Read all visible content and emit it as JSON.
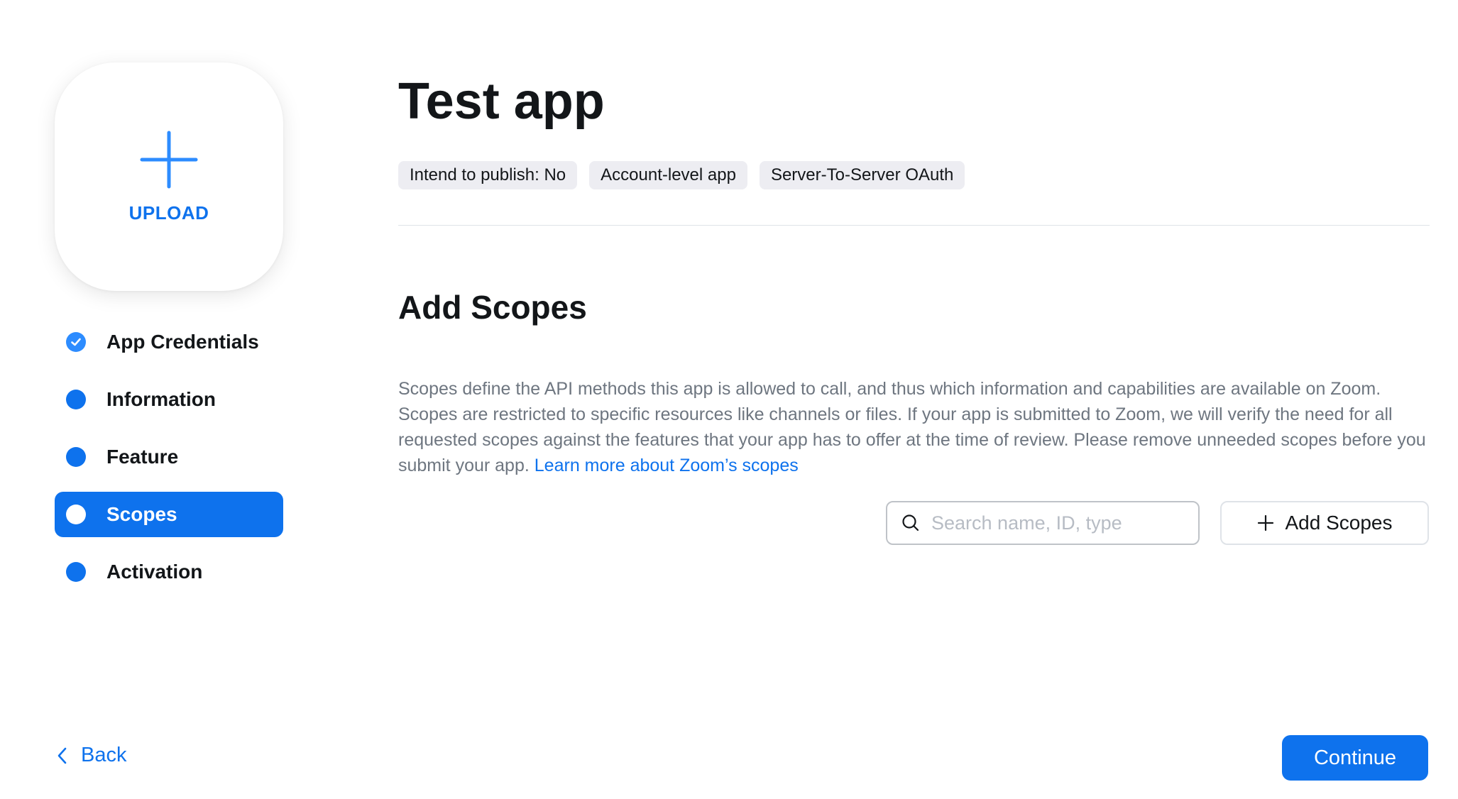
{
  "upload": {
    "label": "UPLOAD",
    "icon": "plus-icon"
  },
  "steps": [
    {
      "label": "App Credentials",
      "state": "completed",
      "icon": "check-circle-icon"
    },
    {
      "label": "Information",
      "state": "pending"
    },
    {
      "label": "Feature",
      "state": "pending"
    },
    {
      "label": "Scopes",
      "state": "active"
    },
    {
      "label": "Activation",
      "state": "pending"
    }
  ],
  "header": {
    "app_title": "Test app",
    "tags": [
      "Intend to publish: No",
      "Account-level app",
      "Server-To-Server OAuth"
    ]
  },
  "section": {
    "title": "Add Scopes",
    "description": "Scopes define the API methods this app is allowed to call, and thus which information and capabilities are available on Zoom. Scopes are restricted to specific resources like channels or files. If your app is submitted to Zoom, we will verify the need for all requested scopes against the features that your app has to offer at the time of review. Please remove unneeded scopes before you submit your app.",
    "learn_more": "Learn more about Zoom’s scopes"
  },
  "search": {
    "placeholder": "Search name, ID, type",
    "value": "",
    "icon": "search-icon"
  },
  "add_scopes_button": {
    "label": "Add Scopes",
    "icon": "plus-icon"
  },
  "footer": {
    "back_label": "Back",
    "continue_label": "Continue"
  },
  "colors": {
    "accent": "#0e72ed",
    "text": "#131619",
    "muted": "#6e7680",
    "tag_bg": "#ededf2"
  }
}
